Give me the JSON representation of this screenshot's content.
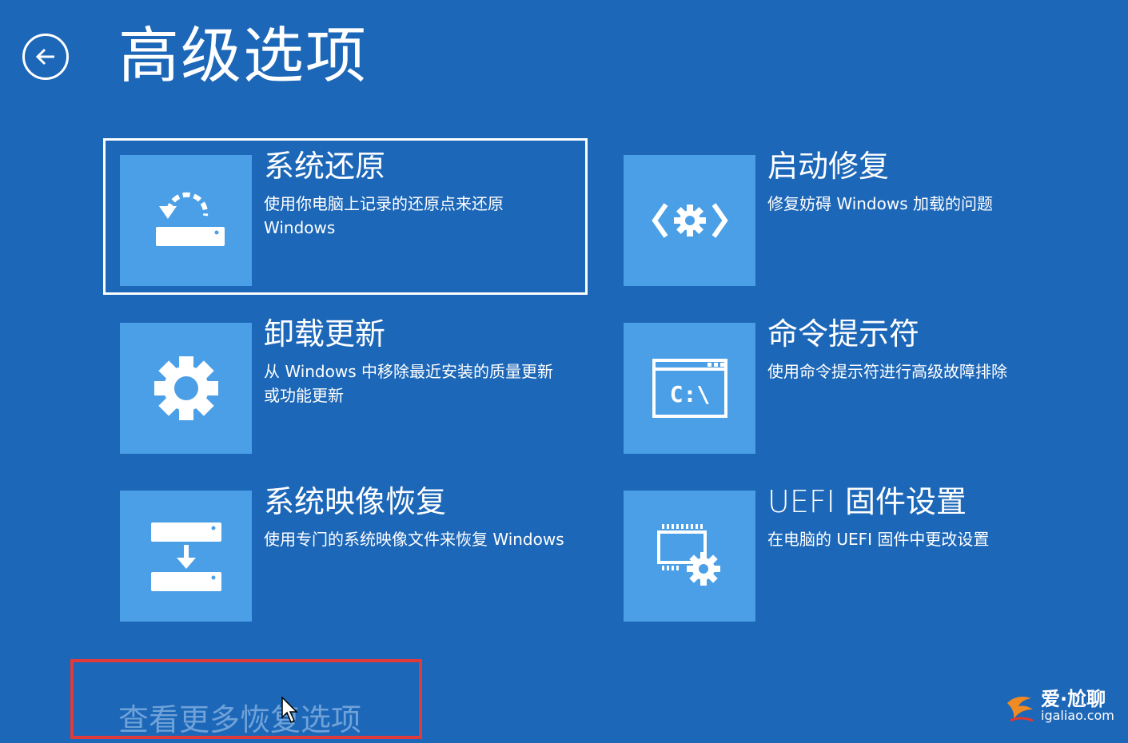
{
  "header": {
    "title": "高级选项"
  },
  "options": [
    {
      "id": "system-restore",
      "title": "系统还原",
      "description": "使用你电脑上记录的还原点来还原 Windows",
      "icon": "restore-drive-icon",
      "selected": true
    },
    {
      "id": "startup-repair",
      "title": "启动修复",
      "description": "修复妨碍 Windows 加载的问题",
      "icon": "code-gear-icon",
      "selected": false
    },
    {
      "id": "uninstall-updates",
      "title": "卸载更新",
      "description": "从 Windows 中移除最近安装的质量更新或功能更新",
      "icon": "gear-icon",
      "selected": false
    },
    {
      "id": "command-prompt",
      "title": "命令提示符",
      "description": "使用命令提示符进行高级故障排除",
      "icon": "command-prompt-icon",
      "icon_text": "C:\\",
      "selected": false
    },
    {
      "id": "system-image-recovery",
      "title": "系统映像恢复",
      "description": "使用专门的系统映像文件来恢复 Windows",
      "icon": "image-recovery-icon",
      "selected": false
    },
    {
      "id": "uefi-settings",
      "title": "UEFI 固件设置",
      "description": "在电脑的 UEFI 固件中更改设置",
      "icon": "chip-gear-icon",
      "selected": false
    }
  ],
  "footer": {
    "more_options": "查看更多恢复选项"
  },
  "watermark": {
    "top": "爱·尬聊",
    "bottom": "igaliao.com"
  },
  "colors": {
    "background": "#1c67b8",
    "tile_icon_bg": "#4b9fe6",
    "highlight": "#e13a3a",
    "more_options_text": "#6fa2d8"
  }
}
